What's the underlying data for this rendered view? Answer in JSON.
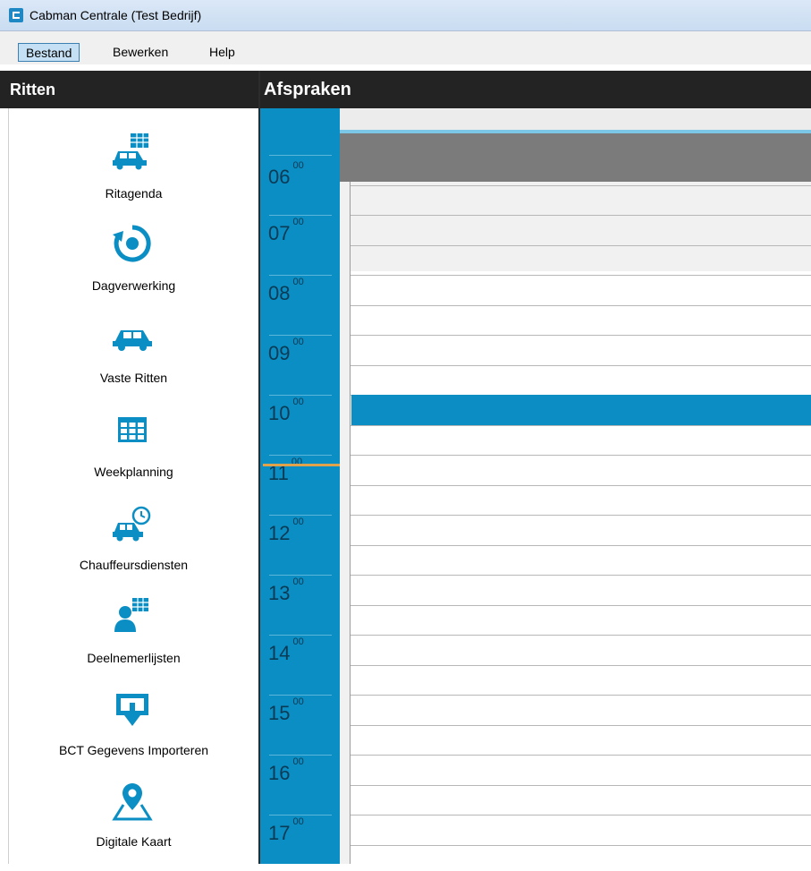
{
  "window": {
    "title": "Cabman Centrale (Test Bedrijf)"
  },
  "menu": {
    "items": [
      "Bestand",
      "Bewerken",
      "Help"
    ],
    "active": "Bestand"
  },
  "sidebar": {
    "header": "Ritten",
    "items": [
      {
        "label": "Ritagenda",
        "icon": "car-calendar-icon"
      },
      {
        "label": "Dagverwerking",
        "icon": "refresh-icon"
      },
      {
        "label": "Vaste Ritten",
        "icon": "car-icon"
      },
      {
        "label": "Weekplanning",
        "icon": "grid-calendar-icon"
      },
      {
        "label": "Chauffeursdiensten",
        "icon": "car-clock-icon"
      },
      {
        "label": "Deelnemerlijsten",
        "icon": "person-list-icon"
      },
      {
        "label": "BCT Gegevens Importeren",
        "icon": "import-icon"
      },
      {
        "label": "Digitale Kaart",
        "icon": "map-pin-icon"
      }
    ]
  },
  "calendar": {
    "header": "Afspraken",
    "minutes_suffix": "00",
    "hours": [
      "07",
      "08",
      "09",
      "10",
      "11",
      "12",
      "13",
      "14",
      "15",
      "16",
      "17"
    ],
    "partial_hour": "06",
    "appointment": {
      "start": "10:00",
      "end": "10:30"
    },
    "current_time": "11:30"
  },
  "colors": {
    "accent": "#0a8ec3",
    "header_bg": "#232323",
    "appointment": "#0c8ec4",
    "now_line": "#e0a24a"
  }
}
